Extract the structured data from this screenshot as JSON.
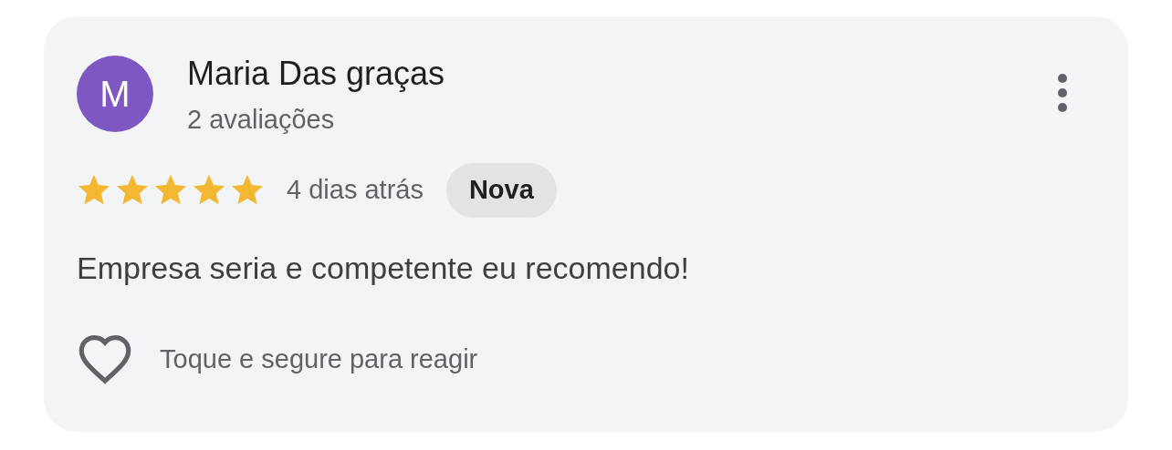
{
  "review": {
    "avatar_letter": "M",
    "author": "Maria Das graças",
    "reviews_count": "2 avaliações",
    "stars": 5,
    "time": "4 dias atrás",
    "badge": "Nova",
    "text": "Empresa seria e competente eu recomendo!",
    "react_hint": "Toque e segure para reagir"
  }
}
